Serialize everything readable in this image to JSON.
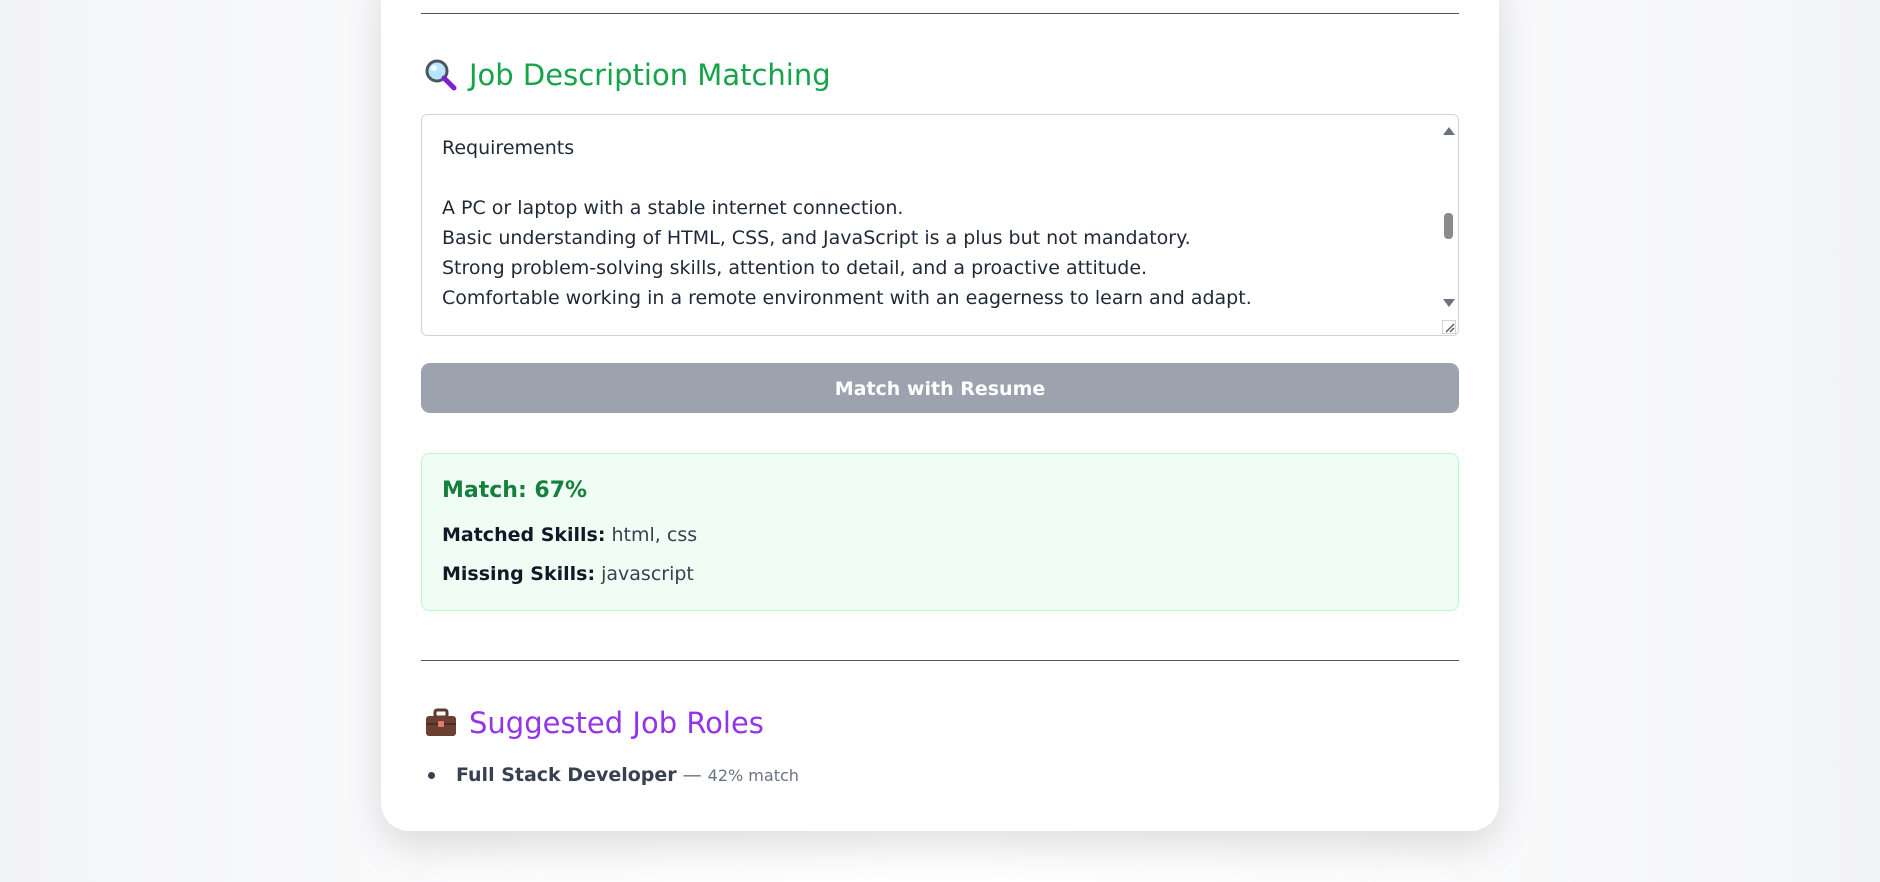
{
  "job_matching": {
    "heading": "Job Description Matching",
    "job_description": "Requirements\n\nA PC or laptop with a stable internet connection.\nBasic understanding of HTML, CSS, and JavaScript is a plus but not mandatory.\nStrong problem-solving skills, attention to detail, and a proactive attitude.\nComfortable working in a remote environment with an eagerness to learn and adapt.",
    "match_button_label": "Match with Resume"
  },
  "result": {
    "match_label": "Match: 67%",
    "match_percent": 67,
    "matched_skills_label": "Matched Skills:",
    "matched_skills_value": "html, css",
    "missing_skills_label": "Missing Skills:",
    "missing_skills_value": "javascript"
  },
  "suggested_roles": {
    "heading": "Suggested Job Roles",
    "items": [
      {
        "role": "Full Stack Developer",
        "separator": "—",
        "match": "42% match"
      }
    ]
  },
  "colors": {
    "green_heading": "#16a34a",
    "purple_heading": "#9333ea",
    "button_disabled": "#9ca3af",
    "result_bg": "#f0fdf4",
    "result_border": "#bbf7d0",
    "result_title": "#15803d"
  },
  "icons": {
    "job_matching": "magnifying-glass-icon",
    "suggested_roles": "briefcase-icon"
  }
}
